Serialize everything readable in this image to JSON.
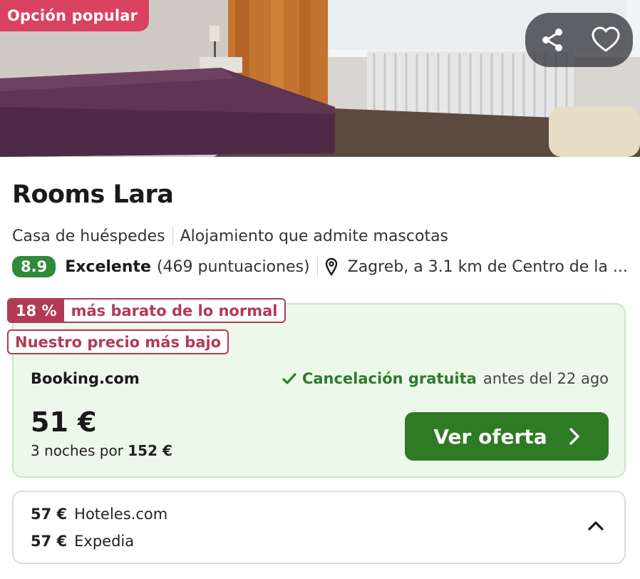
{
  "hero": {
    "badge": "Opción popular",
    "share_icon": "share-icon",
    "favorite_icon": "heart-icon"
  },
  "hotel": {
    "name": "Rooms Lara",
    "type": "Casa de huéspedes",
    "feature": "Alojamiento que admite mascotas",
    "score": "8.9",
    "rating_word": "Excelente",
    "rating_count": "(469 puntuaciones)",
    "location": "Zagreb, a 3.1 km de Centro de la ..."
  },
  "deal": {
    "discount_pct": "18 %",
    "discount_text": "más barato de lo normal",
    "lowest_price_tag": "Nuestro precio más bajo",
    "provider": "Booking.com",
    "cancel_strong": "Cancelación gratuita",
    "cancel_rest": "antes del 22 ago",
    "price": "51 €",
    "nights_text": "3 noches por",
    "total": "152 €",
    "cta_label": "Ver oferta"
  },
  "alternatives": [
    {
      "price": "57 €",
      "provider": "Hoteles.com"
    },
    {
      "price": "57 €",
      "provider": "Expedia"
    }
  ],
  "colors": {
    "popular_badge": "#d9435f",
    "score_badge": "#2f8a3b",
    "deal_tag": "#b33a55",
    "offer_bg": "#ecf8ea",
    "cta": "#2f7a24"
  }
}
